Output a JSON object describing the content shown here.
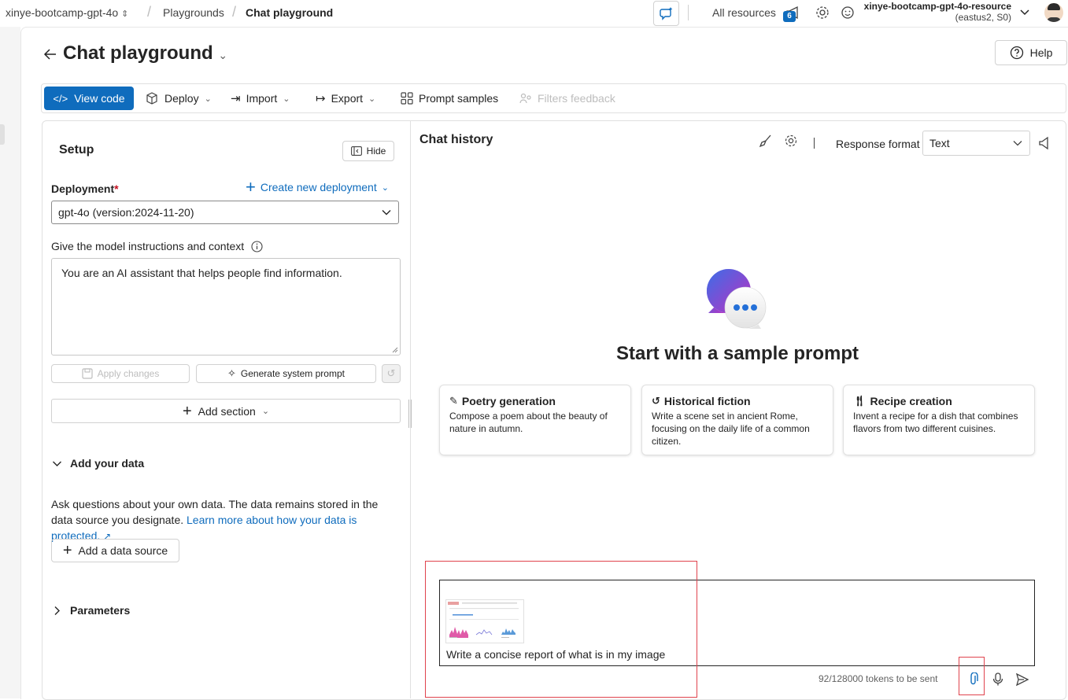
{
  "topbar": {
    "project": "xinye-bootcamp-gpt-4o",
    "crumb1": "Playgrounds",
    "crumb2": "Chat playground",
    "all_resources": "All resources",
    "notif_count": "6",
    "resource_name": "xinye-bootcamp-gpt-4o-resource",
    "resource_region": "(eastus2, S0)"
  },
  "header": {
    "title": "Chat playground",
    "help": "Help"
  },
  "toolbar": {
    "view_code": "View code",
    "deploy": "Deploy",
    "import": "Import",
    "export": "Export",
    "prompt_samples": "Prompt samples",
    "filters_feedback": "Filters feedback"
  },
  "setup": {
    "title": "Setup",
    "hide": "Hide",
    "deployment_label": "Deployment",
    "required_mark": "*",
    "create_new": "Create new deployment",
    "deployment_value": "gpt-4o (version:2024-11-20)",
    "instructions_label": "Give the model instructions and context",
    "instructions_value": "You are an AI assistant that helps people find information.",
    "apply_changes": "Apply changes",
    "generate_prompt": "Generate system prompt",
    "add_section": "Add section",
    "add_your_data": "Add your data",
    "data_desc": "Ask questions about your own data. The data remains stored in the data source you designate.",
    "data_link": "Learn more about how your data is protected.",
    "add_data_source": "Add a data source",
    "parameters": "Parameters"
  },
  "chat": {
    "title": "Chat history",
    "response_format_label": "Response format",
    "response_format_value": "Text",
    "start_heading": "Start with a sample prompt",
    "cards": [
      {
        "title": "Poetry generation",
        "desc": "Compose a poem about the beauty of nature in autumn."
      },
      {
        "title": "Historical fiction",
        "desc": "Write a scene set in ancient Rome, focusing on the daily life of a common citizen."
      },
      {
        "title": "Recipe creation",
        "desc": "Invent a recipe for a dish that combines flavors from two different cuisines."
      }
    ],
    "input_text": "Write a concise report of what is in my image",
    "tokens": "92/128000 tokens to be sent"
  },
  "colors": {
    "accent": "#0f6cbd",
    "highlight": "#e0434d"
  }
}
